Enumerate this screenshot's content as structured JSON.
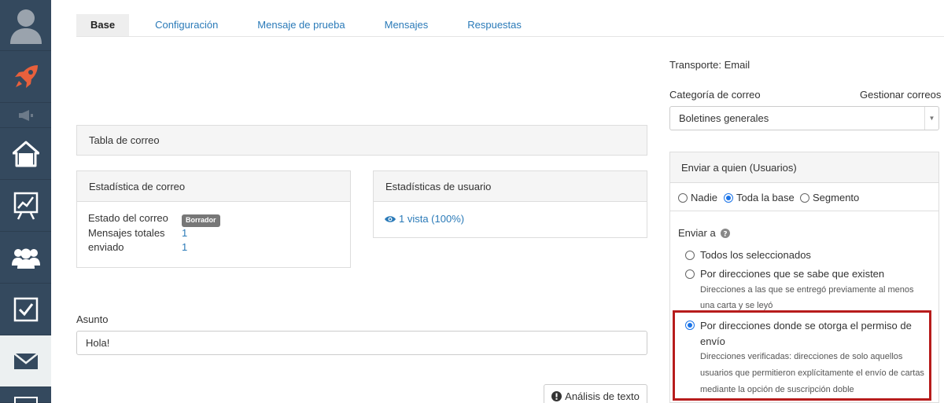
{
  "sidebar": {
    "items": [
      {
        "name": "avatar",
        "icon": "user-silhouette-icon"
      },
      {
        "name": "launch",
        "icon": "rocket-icon"
      },
      {
        "name": "announcements",
        "icon": "megaphone-icon"
      },
      {
        "name": "home",
        "icon": "home-icon"
      },
      {
        "name": "reports",
        "icon": "chart-board-icon"
      },
      {
        "name": "contacts",
        "icon": "users-icon"
      },
      {
        "name": "tasks",
        "icon": "checkbox-icon"
      },
      {
        "name": "email",
        "icon": "envelope-icon"
      }
    ],
    "accent": "#e8603c"
  },
  "tabs": [
    "Base",
    "Configuración",
    "Mensaje de prueba",
    "Mensajes",
    "Respuestas"
  ],
  "mail_table": {
    "title": "Tabla de correo"
  },
  "mail_stats": {
    "title": "Estadística de correo",
    "rows": [
      {
        "key": "Estado del correo",
        "badge": "Borrador"
      },
      {
        "key": "Mensajes totales",
        "value": "1"
      },
      {
        "key": "enviado",
        "value": "1"
      }
    ]
  },
  "user_stats": {
    "title": "Estadísticas de usuario",
    "views": "1 vista (100%)"
  },
  "subject": {
    "label": "Asunto",
    "value": "Hola!"
  },
  "text_analysis_button": "Análisis de texto",
  "right": {
    "transport": "Transporte: Email",
    "category_label": "Categoría de correo",
    "manage_link": "Gestionar correos",
    "category_value": "Boletines generales",
    "send_to": {
      "title": "Enviar a quien (Usuarios)",
      "options": [
        "Nadie",
        "Toda la base",
        "Segmento"
      ],
      "selected": "Toda la base"
    },
    "send_mode": {
      "label": "Enviar a",
      "options": [
        {
          "label": "Todos los seleccionados",
          "desc": ""
        },
        {
          "label": "Por direcciones que se sabe que existen",
          "desc": [
            "Direcciones a las que se entregó previamente al menos",
            "una carta y se leyó"
          ]
        },
        {
          "label": [
            "Por direcciones donde se otorga el permiso de",
            "envío"
          ],
          "desc": [
            "Direcciones verificadas: direcciones de solo aquellos",
            "usuarios que permitieron explícitamente el envío de cartas",
            "mediante la opción de suscripción doble"
          ]
        }
      ],
      "selected_index": 2
    }
  },
  "colors": {
    "link": "#2a7ab8",
    "highlight": "#b71c1c",
    "sidebar": "#34495e",
    "radio": "#1a73e8"
  }
}
